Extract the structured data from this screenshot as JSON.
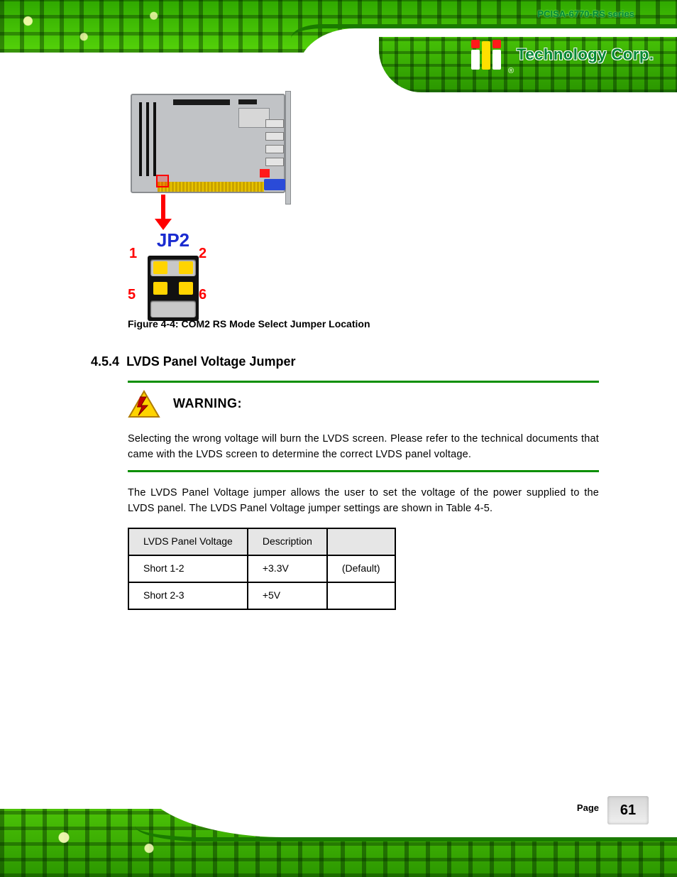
{
  "doc_title": "PCISA-6770-RS series",
  "brand": {
    "reg": "®",
    "name": "Technology Corp."
  },
  "figure": {
    "jumper_label": "JP2",
    "pins": {
      "n1": "1",
      "n2": "2",
      "n5": "5",
      "n6": "6"
    },
    "caption": "Figure 4-4: COM2 RS Mode Select Jumper Location"
  },
  "section": {
    "number": "4.5.4",
    "title": "LVDS Panel Voltage Jumper"
  },
  "warning": {
    "title": "WARNING:",
    "body": "Selecting the wrong voltage will burn the LVDS screen. Please refer to the technical documents that came with the LVDS screen to determine the correct LVDS panel voltage."
  },
  "paragraph": "The LVDS Panel Voltage jumper allows the user to set the voltage of the power supplied to the LVDS panel. The LVDS Panel Voltage jumper settings are shown in Table 4-5.",
  "table": {
    "headers": [
      "LVDS Panel Voltage",
      "Description",
      ""
    ],
    "rows": [
      [
        "Short 1-2",
        "+3.3V",
        "(Default)"
      ],
      [
        "Short 2-3",
        "+5V",
        ""
      ]
    ]
  },
  "footer": {
    "page_label": "Page",
    "page_number": "61"
  }
}
